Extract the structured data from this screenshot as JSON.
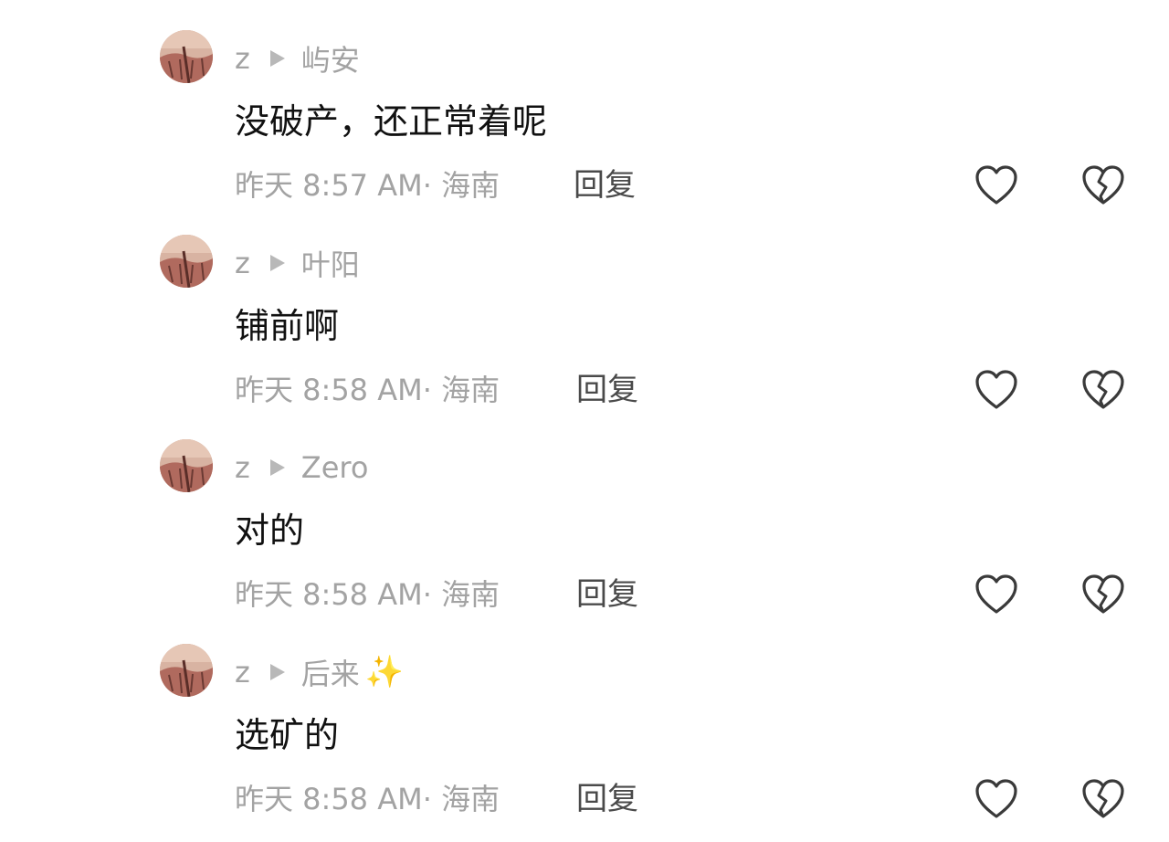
{
  "comments": [
    {
      "user": "z",
      "reply_to": "屿安",
      "text": "没破产，还正常着呢",
      "time": "昨天 8:57 AM",
      "location": "· 海南",
      "reply_label": "回复",
      "sparkle": ""
    },
    {
      "user": "z",
      "reply_to": "叶阳",
      "text": "铺前啊",
      "time": "昨天 8:58 AM",
      "location": "· 海南",
      "reply_label": "回复",
      "sparkle": ""
    },
    {
      "user": "z",
      "reply_to": "Zero",
      "text": "对的",
      "time": "昨天 8:58 AM",
      "location": "· 海南",
      "reply_label": "回复",
      "sparkle": ""
    },
    {
      "user": "z",
      "reply_to": "后来",
      "text": "选矿的",
      "time": "昨天 8:58 AM",
      "location": "· 海南",
      "reply_label": "回复",
      "sparkle": "✨"
    }
  ],
  "icons": {
    "avatar": "avatar-photo",
    "reply_arrow": "play-arrow-icon",
    "like": "heart-outline-icon",
    "dislike": "broken-heart-icon"
  },
  "colors": {
    "secondary_text": "#a3a3a3",
    "primary_text": "#111111",
    "reply_text": "#4a4a4a",
    "icon_stroke": "#3a3a3a",
    "sparkle": "#f2c232"
  }
}
